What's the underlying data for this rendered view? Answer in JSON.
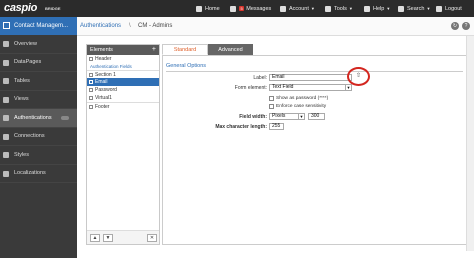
{
  "brand": {
    "logo": "caspio",
    "sub": "BRIDGE"
  },
  "topnav": [
    {
      "label": "Home",
      "icon": "home-icon"
    },
    {
      "label": "Messages",
      "icon": "mail-icon",
      "badge": "5"
    },
    {
      "label": "Account",
      "icon": "account-icon"
    },
    {
      "label": "Tools",
      "icon": "tools-icon"
    },
    {
      "label": "Help",
      "icon": "help-icon"
    },
    {
      "label": "Search",
      "icon": "search-icon"
    },
    {
      "label": "Logout",
      "icon": "logout-icon"
    }
  ],
  "sidebar": {
    "header": "Contact Managem...",
    "items": [
      {
        "label": "Overview",
        "icon": "overview-icon"
      },
      {
        "label": "DataPages",
        "icon": "datapages-icon"
      },
      {
        "label": "Tables",
        "icon": "tables-icon"
      },
      {
        "label": "Views",
        "icon": "views-icon"
      },
      {
        "label": "Authentications",
        "icon": "lock-icon",
        "active": true
      },
      {
        "label": "Connections",
        "icon": "connections-icon"
      },
      {
        "label": "Styles",
        "icon": "styles-icon"
      },
      {
        "label": "Localizations",
        "icon": "globe-icon"
      }
    ]
  },
  "breadcrumb": {
    "parent": "Authentications",
    "separator": "\\",
    "current": "CM - Admins"
  },
  "elements": {
    "title": "Elements",
    "add": "+",
    "header_item": "Header",
    "subheading": "Authentication Fields",
    "items": [
      "Section 1",
      "Email",
      "Password",
      "Virtual1"
    ],
    "footer_item": "Footer",
    "btn_up": "▲",
    "btn_down": "▼",
    "btn_delete": "✕"
  },
  "tabs": {
    "standard": "Standard",
    "advanced": "Advanced"
  },
  "properties": {
    "section": "General Options",
    "label_label": "Label:",
    "label_value": "Email",
    "form_element_label": "Form element:",
    "form_element_value": "Text Field",
    "show_password": "Show as password (****)",
    "enforce_case": "Enforce case sensitivity",
    "field_width_label": "Field width:",
    "field_width_unit": "Pixels",
    "field_width_value": "300",
    "max_length_label": "Max character length:",
    "max_length_value": "255"
  }
}
